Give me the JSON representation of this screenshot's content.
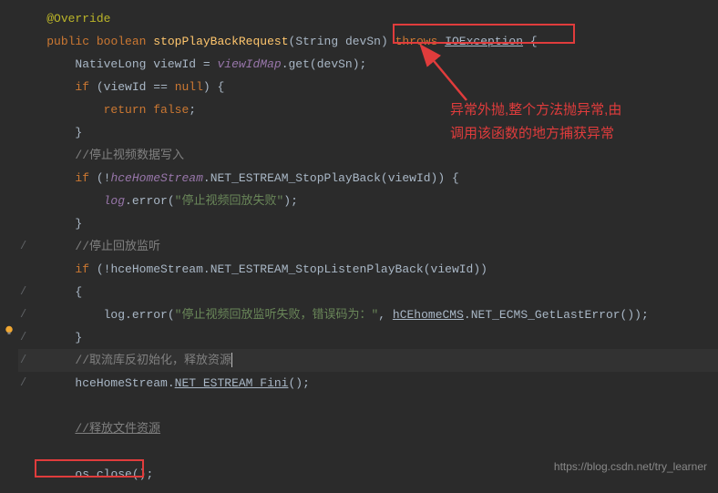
{
  "code": {
    "l1_annotation": "@Override",
    "l2_public": "public",
    "l2_boolean": "boolean",
    "l2_method": "stopPlayBackRequest",
    "l2_param_type": "String",
    "l2_param_name": "devSn",
    "l2_throws": "throws",
    "l2_exception": "IOException",
    "l3_type": "NativeLong",
    "l3_var": "viewId",
    "l3_field": "viewIdMap",
    "l3_method": "get",
    "l3_arg": "devSn",
    "l4_if": "if",
    "l4_cond_var": "viewId",
    "l4_null": "null",
    "l5_return": "return false",
    "l7_comment": "//停止视频数据写入",
    "l8_if": "if",
    "l8_field": "hceHomeStream",
    "l8_method": "NET_ESTREAM_StopPlayBack",
    "l8_arg": "viewId",
    "l9_log": "log",
    "l9_method": "error",
    "l9_string": "\"停止视频回放失败\"",
    "l11_comment": "//停止回放监听",
    "l12_if": "if",
    "l12_field": "hceHomeStream",
    "l12_method": "NET_ESTREAM_StopListenPlayBack",
    "l12_arg": "viewId",
    "l14_log": "log",
    "l14_method": "error",
    "l14_string": "\"停止视频回放监听失败，错误码为：\"",
    "l14_obj": "hCEhomeCMS",
    "l14_call": "NET_ECMS_GetLastError",
    "l16_comment": "//取流库反初始化，释放资源",
    "l17_field": "hceHomeStream",
    "l17_method": "NET_ESTREAM_Fini",
    "l19_comment": "//释放文件资源",
    "l21_obj": "os",
    "l21_method": "close"
  },
  "annotation": {
    "text": "异常外抛,整个方法抛异常,由\n调用该函数的地方捕获异常"
  },
  "watermark": "https://blog.csdn.net/try_learner",
  "gutter": {
    "slash": "/"
  }
}
